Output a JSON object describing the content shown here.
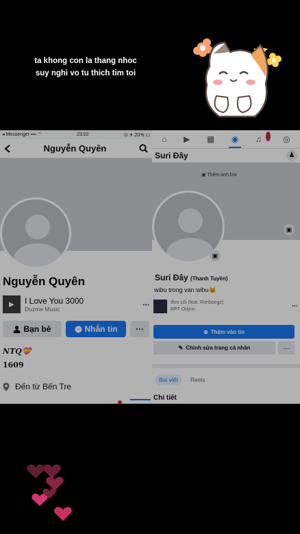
{
  "caption": {
    "line1": "ta khong con la thang nhoc",
    "line2": "suy nghi vo tu thich tim toi"
  },
  "left_screen": {
    "status": {
      "carrier": "◂ Messenger ▪▪▪ ⌔",
      "time": "23:02",
      "battery": "⊙ ✈ 20% ▭"
    },
    "nav_title": "Nguyễn Quyên",
    "profile_name": "Nguyễn Quyên",
    "music": {
      "title": "I Love You 3000",
      "subtitle": "Duzme Music"
    },
    "friends_button": "Bạn bè",
    "message_button": "Nhắn tin",
    "more_label": "···",
    "bio_line1": "NTQ💝",
    "bio_line2": "1609",
    "location_text": "Đến từ Bến Tre"
  },
  "right_screen": {
    "header_name": "Suri Đây",
    "add_cover_label": "Thêm ảnh bìa",
    "profile_name": "Suri Đây",
    "alt_name": "(Thanh Tuyền)",
    "bio": "wibu trong van wibu😼",
    "music": {
      "title": "đơn côi (feat. Ronboogz)",
      "subtitle": "RPT Orijinn"
    },
    "add_story_button": "Thêm vào tin",
    "edit_profile_button": "Chỉnh sửa trang cá nhân",
    "more_label": "···",
    "tabs": [
      "Bài viết",
      "Reels"
    ],
    "details_heading": "Chi tiết",
    "notification_count": "4"
  },
  "colors": {
    "accent": "#1877f2",
    "background": "#000000",
    "badge": "#e41e3f"
  },
  "icons": [
    "back-arrow-icon",
    "search-icon",
    "home-icon",
    "video-icon",
    "marketplace-icon",
    "profile-icon",
    "bell-icon",
    "menu-avatar-icon",
    "camera-icon",
    "pin-icon",
    "messenger-icon",
    "person-icon",
    "pencil-icon",
    "plus-circle-icon"
  ]
}
